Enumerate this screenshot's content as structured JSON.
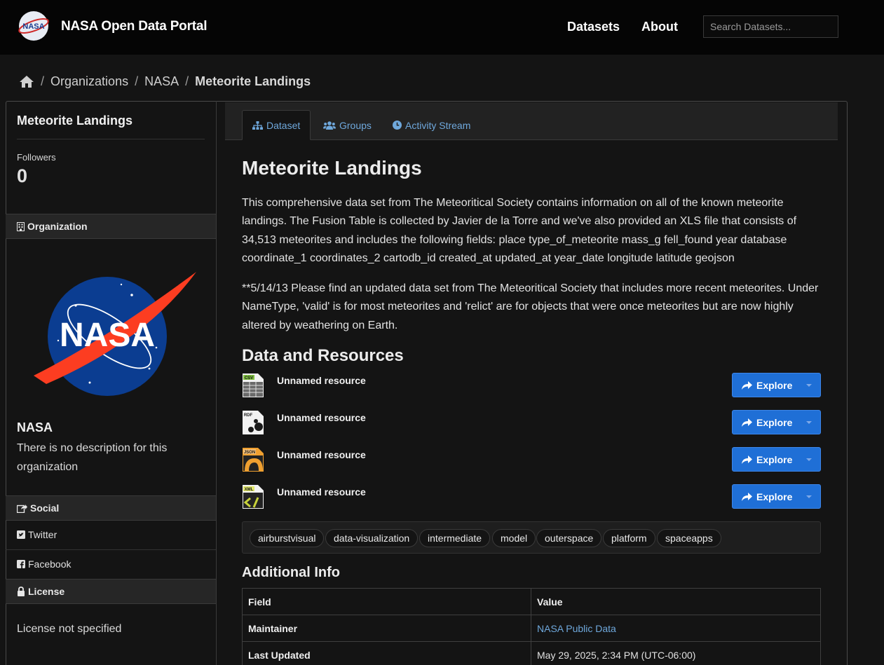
{
  "header": {
    "site_title": "NASA Open Data Portal",
    "logo_text": "NASA",
    "nav": [
      "Datasets",
      "About"
    ],
    "search_placeholder": "Search Datasets..."
  },
  "breadcrumb": {
    "items": [
      "Organizations",
      "NASA"
    ],
    "current": "Meteorite Landings"
  },
  "sidebar": {
    "title": "Meteorite Landings",
    "followers_label": "Followers",
    "followers_count": "0",
    "organization_heading": "Organization",
    "org_logo_text": "NASA",
    "org_name": "NASA",
    "org_description": "There is no description for this organization",
    "social_heading": "Social",
    "social_links": [
      "Twitter",
      "Facebook"
    ],
    "license_heading": "License",
    "license_text": "License not specified"
  },
  "tabs": [
    "Dataset",
    "Groups",
    "Activity Stream"
  ],
  "dataset": {
    "title": "Meteorite Landings",
    "description_1": "This comprehensive data set from The Meteoritical Society contains information on all of the known meteorite landings. The Fusion Table is collected by Javier de la Torre and we've also provided an XLS file that consists of 34,513 meteorites and includes the following fields: place type_of_meteorite mass_g fell_found year database coordinate_1 coordinates_2 cartodb_id created_at updated_at year_date longitude latitude geojson",
    "description_2": "**5/14/13 Please find an updated data set from The Meteoritical Society that includes more recent meteorites. Under NameType, 'valid' is for most meteorites and 'relict' are for objects that were once meteorites but are now highly altered by weathering on Earth."
  },
  "resources": {
    "heading": "Data and Resources",
    "items": [
      {
        "format": "CSV",
        "name": "Unnamed resource",
        "action": "Explore",
        "color": "#7fbf3f"
      },
      {
        "format": "RDF",
        "name": "Unnamed resource",
        "action": "Explore",
        "color": "#bbbbbb"
      },
      {
        "format": "JSON",
        "name": "Unnamed resource",
        "action": "Explore",
        "color": "#f0a030"
      },
      {
        "format": "XML",
        "name": "Unnamed resource",
        "action": "Explore",
        "color": "#c8d23a"
      }
    ]
  },
  "tags": [
    "airburstvisual",
    "data-visualization",
    "intermediate",
    "model",
    "outerspace",
    "platform",
    "spaceapps"
  ],
  "additional_info": {
    "heading": "Additional Info",
    "columns": [
      "Field",
      "Value"
    ],
    "rows": [
      {
        "field": "Maintainer",
        "value": "NASA Public Data"
      },
      {
        "field": "Last Updated",
        "value": "May 29, 2025, 2:34 PM (UTC-06:00)"
      }
    ]
  },
  "colors": {
    "background": "#141414",
    "topbar": "#050505",
    "link": "#6fa8dc",
    "button": "#1f6fd6"
  }
}
